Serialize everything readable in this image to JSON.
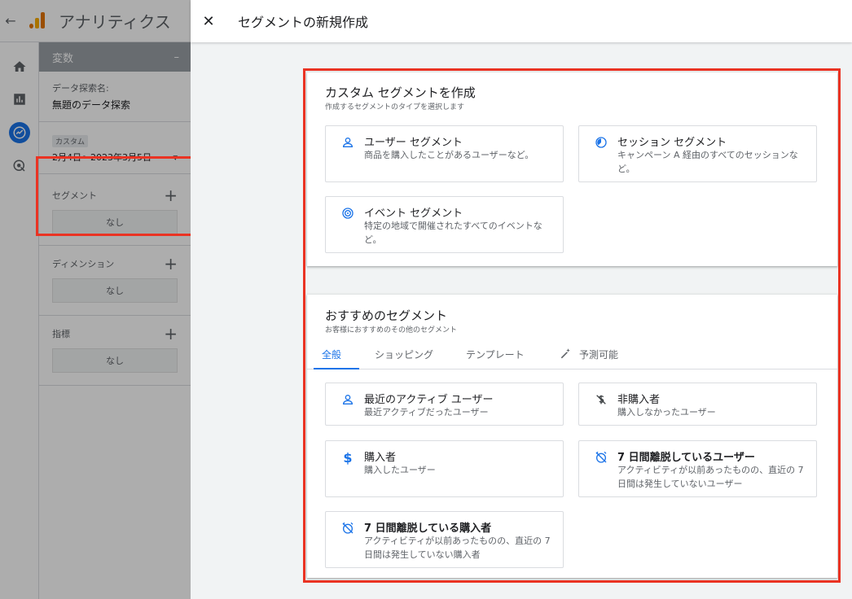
{
  "background": {
    "app_title": "アナリティクス",
    "panel": {
      "header": "変数",
      "exploration_label": "データ探索名:",
      "exploration_name": "無題のデータ探索",
      "date_chip": "カスタム",
      "date_range": "2月4日〜2023年3月5日",
      "segments_label": "セグメント",
      "segments_value": "なし",
      "dimensions_label": "ディメンション",
      "dimensions_value": "なし",
      "metrics_label": "指標",
      "metrics_value": "なし"
    }
  },
  "dialog": {
    "title": "セグメントの新規作成",
    "custom": {
      "title": "カスタム セグメントを作成",
      "subtitle": "作成するセグメントのタイプを選択します",
      "options": [
        {
          "title": "ユーザー セグメント",
          "desc": "商品を購入したことがあるユーザーなど。",
          "icon": "person-icon"
        },
        {
          "title": "セッション セグメント",
          "desc": "キャンペーン A 経由のすべてのセッションなど。",
          "icon": "session-icon"
        },
        {
          "title": "イベント セグメント",
          "desc": "特定の地域で開催されたすべてのイベントなど。",
          "icon": "event-icon"
        }
      ]
    },
    "recommended": {
      "title": "おすすめのセグメント",
      "subtitle": "お客様におすすめのその他のセグメント",
      "tabs": [
        "全般",
        "ショッピング",
        "テンプレート",
        "予測可能"
      ],
      "options": [
        {
          "title": "最近のアクティブ ユーザー",
          "desc": "最近アクティブだったユーザー",
          "icon": "person-icon"
        },
        {
          "title": "非購入者",
          "desc": "購入しなかったユーザー",
          "icon": "no-purchase-icon"
        },
        {
          "title": "購入者",
          "desc": "購入したユーザー",
          "icon": "dollar-icon"
        },
        {
          "title": "7 日間離脱しているユーザー",
          "desc": "アクティビティが以前あったものの、直近の 7 日間は発生していないユーザー",
          "icon": "alarm-off-icon"
        },
        {
          "title": "7 日間離脱している購入者",
          "desc": "アクティビティが以前あったものの、直近の 7 日間は発生していない購入者",
          "icon": "alarm-off-icon"
        }
      ]
    }
  },
  "colors": {
    "accent": "#1a73e8",
    "highlight": "#ea3323"
  }
}
